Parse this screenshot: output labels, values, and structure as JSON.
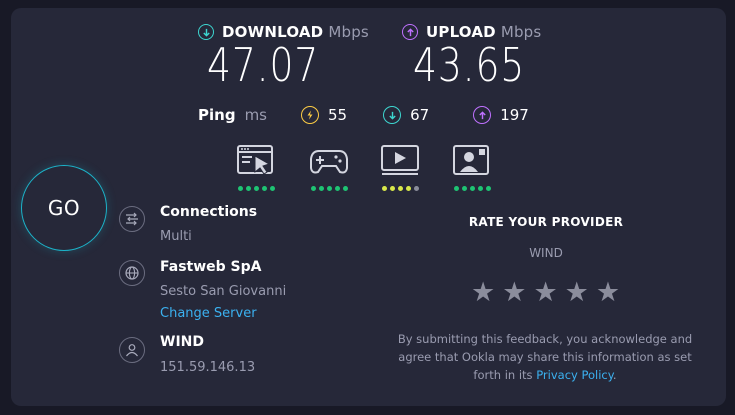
{
  "download": {
    "label": "DOWNLOAD",
    "unit": "Mbps",
    "value": "47.07",
    "color": "#3dd6d0",
    "icon": "arrow-down-icon"
  },
  "upload": {
    "label": "UPLOAD",
    "unit": "Mbps",
    "value": "43.65",
    "color": "#bf71ff",
    "icon": "arrow-up-icon"
  },
  "ping": {
    "label": "Ping",
    "unit": "ms",
    "idle": {
      "value": "55",
      "color": "#fbcb44",
      "icon": "lightning-icon"
    },
    "download": {
      "value": "67",
      "color": "#3dd6d0",
      "icon": "arrow-down-icon"
    },
    "upload": {
      "value": "197",
      "color": "#bf71ff",
      "icon": "arrow-up-icon"
    }
  },
  "performance": [
    {
      "icon": "web-browsing-icon",
      "rating": 5,
      "max": 5
    },
    {
      "icon": "gaming-controller-icon",
      "rating": 5,
      "max": 5
    },
    {
      "icon": "video-streaming-icon",
      "rating": 4,
      "max": 5
    },
    {
      "icon": "video-chat-icon",
      "rating": 5,
      "max": 5
    }
  ],
  "go_label": "GO",
  "connections": {
    "title": "Connections",
    "value": "Multi",
    "icon": "connections-icon"
  },
  "server": {
    "title": "Fastweb SpA",
    "location": "Sesto San Giovanni",
    "change_label": "Change Server",
    "icon": "globe-icon"
  },
  "provider": {
    "title": "WIND",
    "ip": "151.59.146.13",
    "icon": "user-icon"
  },
  "rate": {
    "title": "RATE YOUR PROVIDER",
    "provider": "WIND",
    "stars": 5,
    "disclaimer_line1": "By submitting this feedback, you acknowledge and",
    "disclaimer_line2": "agree that Ookla may share this information as set",
    "disclaimer_line3_prefix": "forth in its ",
    "privacy_link": "Privacy Policy",
    "disclaimer_line3_suffix": "."
  },
  "colors": {
    "background": "#181926",
    "panel": "#262839",
    "link": "#3bb1f0",
    "go_ring": "#1cb3c9",
    "dot_green": "#1ec473"
  }
}
